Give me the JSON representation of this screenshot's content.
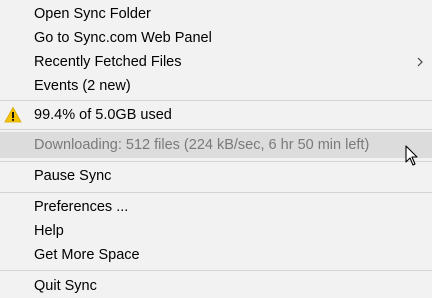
{
  "menu": {
    "items": [
      {
        "label": "Open Sync Folder"
      },
      {
        "label": "Go to Sync.com Web Panel"
      },
      {
        "label": "Recently Fetched Files"
      },
      {
        "label": "Events (2 new)"
      },
      {
        "label": "99.4% of 5.0GB used"
      },
      {
        "label": "Downloading: 512 files (224 kB/sec, 6 hr 50 min left)"
      },
      {
        "label": "Pause Sync"
      },
      {
        "label": "Preferences ..."
      },
      {
        "label": "Help"
      },
      {
        "label": "Get More Space"
      },
      {
        "label": "Quit Sync"
      }
    ],
    "icons": {
      "warning": "warning-icon",
      "submenu": "chevron-right-icon",
      "cursor": "mouse-cursor-icon"
    },
    "colors": {
      "background": "#f2f2f2",
      "disabled_row": "#dcdcdc",
      "disabled_text": "#7a7a7a",
      "warning_fill": "#f5c400"
    }
  }
}
